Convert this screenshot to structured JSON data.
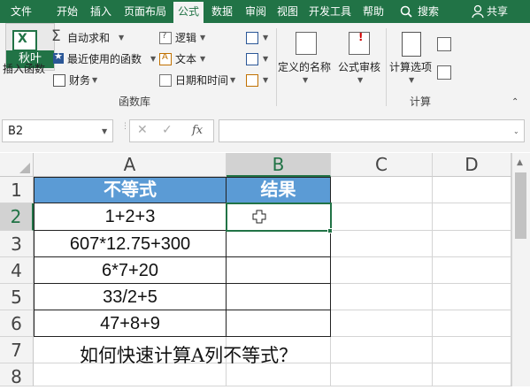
{
  "menu": {
    "tabs": [
      "文件",
      "开始",
      "插入",
      "页面布局",
      "公式",
      "数据",
      "审阅",
      "视图",
      "开发工具",
      "帮助"
    ],
    "search": "搜索",
    "share": "共享"
  },
  "ribbon": {
    "insert_function": "插入函数",
    "autosum": "自动求和",
    "recent": "最近使用的函数",
    "financial": "财务",
    "logical": "逻辑",
    "text": "文本",
    "datetime": "日期和时间",
    "define_name": "定义的名称",
    "formula_audit": "公式审核",
    "calc_options": "计算选项",
    "group_library": "函数库",
    "group_calc": "计算"
  },
  "watermark": "秋叶",
  "formula_bar": {
    "name_box": "B2",
    "cancel": "✕",
    "confirm": "✓",
    "fx": "fx",
    "formula": ""
  },
  "sheet": {
    "columns": [
      "A",
      "B",
      "C",
      "D"
    ],
    "rows": [
      "1",
      "2",
      "3",
      "4",
      "5",
      "6",
      "7",
      "8"
    ],
    "headers": [
      "不等式",
      "结果"
    ],
    "expressions": [
      "1+2+3",
      "607*12.75+300",
      "6*7+20",
      "33/2+5",
      "47+8+9"
    ],
    "results": [
      "",
      "",
      "",
      "",
      ""
    ],
    "active_cell": "B2",
    "note": "如何快速计算A列不等式？"
  },
  "colors": {
    "menu_bg": "#217346",
    "header_fill": "#5b9bd5",
    "selection": "#217346"
  }
}
